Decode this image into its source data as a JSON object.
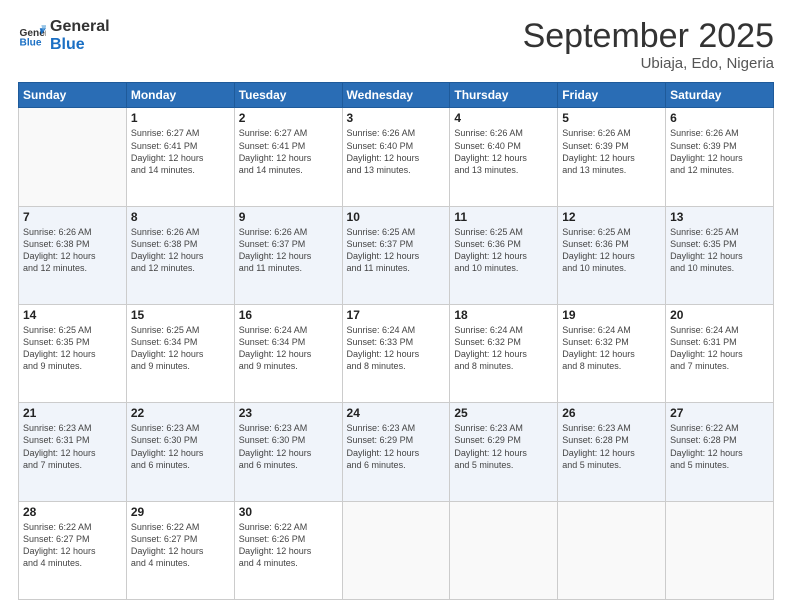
{
  "logo": {
    "line1": "General",
    "line2": "Blue"
  },
  "header": {
    "month": "September 2025",
    "location": "Ubiaja, Edo, Nigeria"
  },
  "days_of_week": [
    "Sunday",
    "Monday",
    "Tuesday",
    "Wednesday",
    "Thursday",
    "Friday",
    "Saturday"
  ],
  "weeks": [
    [
      {
        "day": "",
        "data": ""
      },
      {
        "day": "1",
        "data": "Sunrise: 6:27 AM\nSunset: 6:41 PM\nDaylight: 12 hours\nand 14 minutes."
      },
      {
        "day": "2",
        "data": "Sunrise: 6:27 AM\nSunset: 6:41 PM\nDaylight: 12 hours\nand 14 minutes."
      },
      {
        "day": "3",
        "data": "Sunrise: 6:26 AM\nSunset: 6:40 PM\nDaylight: 12 hours\nand 13 minutes."
      },
      {
        "day": "4",
        "data": "Sunrise: 6:26 AM\nSunset: 6:40 PM\nDaylight: 12 hours\nand 13 minutes."
      },
      {
        "day": "5",
        "data": "Sunrise: 6:26 AM\nSunset: 6:39 PM\nDaylight: 12 hours\nand 13 minutes."
      },
      {
        "day": "6",
        "data": "Sunrise: 6:26 AM\nSunset: 6:39 PM\nDaylight: 12 hours\nand 12 minutes."
      }
    ],
    [
      {
        "day": "7",
        "data": "Sunrise: 6:26 AM\nSunset: 6:38 PM\nDaylight: 12 hours\nand 12 minutes."
      },
      {
        "day": "8",
        "data": "Sunrise: 6:26 AM\nSunset: 6:38 PM\nDaylight: 12 hours\nand 12 minutes."
      },
      {
        "day": "9",
        "data": "Sunrise: 6:26 AM\nSunset: 6:37 PM\nDaylight: 12 hours\nand 11 minutes."
      },
      {
        "day": "10",
        "data": "Sunrise: 6:25 AM\nSunset: 6:37 PM\nDaylight: 12 hours\nand 11 minutes."
      },
      {
        "day": "11",
        "data": "Sunrise: 6:25 AM\nSunset: 6:36 PM\nDaylight: 12 hours\nand 10 minutes."
      },
      {
        "day": "12",
        "data": "Sunrise: 6:25 AM\nSunset: 6:36 PM\nDaylight: 12 hours\nand 10 minutes."
      },
      {
        "day": "13",
        "data": "Sunrise: 6:25 AM\nSunset: 6:35 PM\nDaylight: 12 hours\nand 10 minutes."
      }
    ],
    [
      {
        "day": "14",
        "data": "Sunrise: 6:25 AM\nSunset: 6:35 PM\nDaylight: 12 hours\nand 9 minutes."
      },
      {
        "day": "15",
        "data": "Sunrise: 6:25 AM\nSunset: 6:34 PM\nDaylight: 12 hours\nand 9 minutes."
      },
      {
        "day": "16",
        "data": "Sunrise: 6:24 AM\nSunset: 6:34 PM\nDaylight: 12 hours\nand 9 minutes."
      },
      {
        "day": "17",
        "data": "Sunrise: 6:24 AM\nSunset: 6:33 PM\nDaylight: 12 hours\nand 8 minutes."
      },
      {
        "day": "18",
        "data": "Sunrise: 6:24 AM\nSunset: 6:32 PM\nDaylight: 12 hours\nand 8 minutes."
      },
      {
        "day": "19",
        "data": "Sunrise: 6:24 AM\nSunset: 6:32 PM\nDaylight: 12 hours\nand 8 minutes."
      },
      {
        "day": "20",
        "data": "Sunrise: 6:24 AM\nSunset: 6:31 PM\nDaylight: 12 hours\nand 7 minutes."
      }
    ],
    [
      {
        "day": "21",
        "data": "Sunrise: 6:23 AM\nSunset: 6:31 PM\nDaylight: 12 hours\nand 7 minutes."
      },
      {
        "day": "22",
        "data": "Sunrise: 6:23 AM\nSunset: 6:30 PM\nDaylight: 12 hours\nand 6 minutes."
      },
      {
        "day": "23",
        "data": "Sunrise: 6:23 AM\nSunset: 6:30 PM\nDaylight: 12 hours\nand 6 minutes."
      },
      {
        "day": "24",
        "data": "Sunrise: 6:23 AM\nSunset: 6:29 PM\nDaylight: 12 hours\nand 6 minutes."
      },
      {
        "day": "25",
        "data": "Sunrise: 6:23 AM\nSunset: 6:29 PM\nDaylight: 12 hours\nand 5 minutes."
      },
      {
        "day": "26",
        "data": "Sunrise: 6:23 AM\nSunset: 6:28 PM\nDaylight: 12 hours\nand 5 minutes."
      },
      {
        "day": "27",
        "data": "Sunrise: 6:22 AM\nSunset: 6:28 PM\nDaylight: 12 hours\nand 5 minutes."
      }
    ],
    [
      {
        "day": "28",
        "data": "Sunrise: 6:22 AM\nSunset: 6:27 PM\nDaylight: 12 hours\nand 4 minutes."
      },
      {
        "day": "29",
        "data": "Sunrise: 6:22 AM\nSunset: 6:27 PM\nDaylight: 12 hours\nand 4 minutes."
      },
      {
        "day": "30",
        "data": "Sunrise: 6:22 AM\nSunset: 6:26 PM\nDaylight: 12 hours\nand 4 minutes."
      },
      {
        "day": "",
        "data": ""
      },
      {
        "day": "",
        "data": ""
      },
      {
        "day": "",
        "data": ""
      },
      {
        "day": "",
        "data": ""
      }
    ]
  ]
}
